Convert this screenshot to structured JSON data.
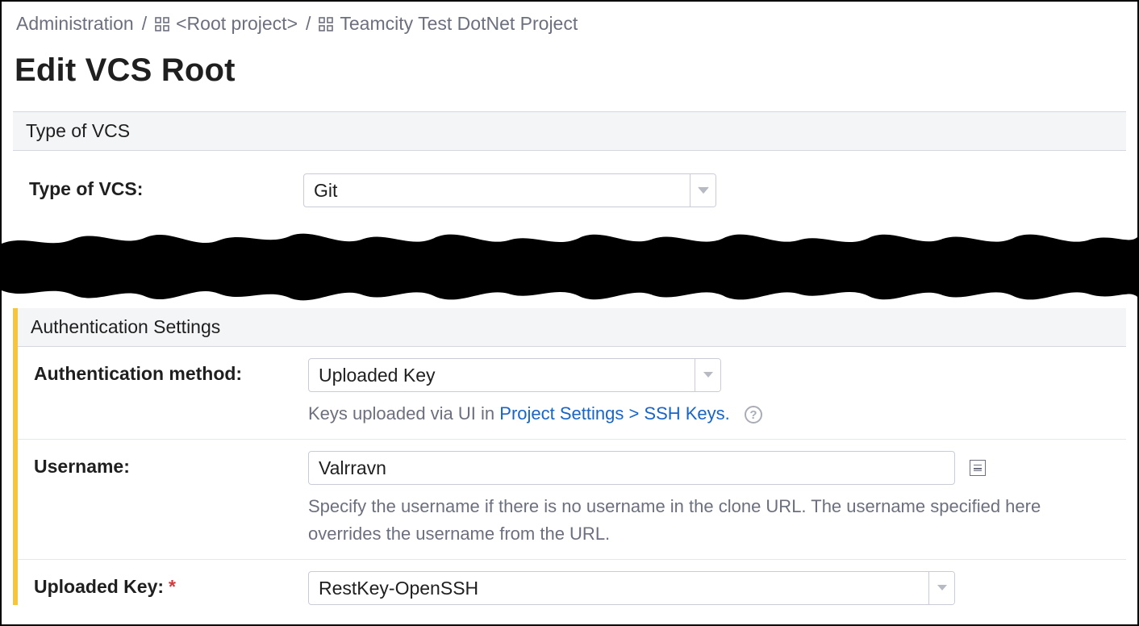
{
  "breadcrumbs": {
    "admin": "Administration",
    "root": "<Root project>",
    "project": "Teamcity Test DotNet Project"
  },
  "page_title": "Edit VCS Root",
  "section_vcs_type": {
    "header": "Type of VCS",
    "label": "Type of VCS:",
    "selected": "Git"
  },
  "section_auth": {
    "header": "Authentication Settings",
    "method_label": "Authentication method:",
    "method_selected": "Uploaded Key",
    "method_help_prefix": "Keys uploaded via UI in ",
    "method_help_link": "Project Settings > SSH Keys.",
    "username_label": "Username:",
    "username_value": "Valrravn",
    "username_help": "Specify the username if there is no username in the clone URL. The username specified here overrides the username from the URL.",
    "uploaded_key_label": "Uploaded Key:",
    "uploaded_key_selected": "RestKey-OpenSSH"
  }
}
